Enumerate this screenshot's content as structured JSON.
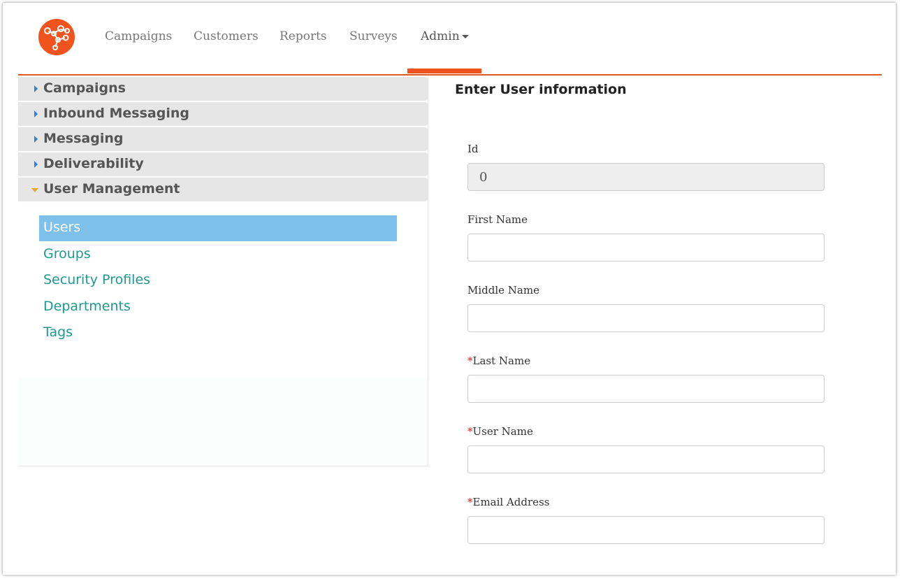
{
  "brand": {
    "logo_icon": "network-nodes-icon",
    "accent": "#f0531d"
  },
  "nav": {
    "items": [
      "Campaigns",
      "Customers",
      "Reports",
      "Surveys"
    ],
    "admin_label": "Admin"
  },
  "sidebar": {
    "sections": [
      {
        "label": "Campaigns",
        "expanded": false
      },
      {
        "label": "Inbound Messaging",
        "expanded": false
      },
      {
        "label": "Messaging",
        "expanded": false
      },
      {
        "label": "Deliverability",
        "expanded": false
      },
      {
        "label": "User Management",
        "expanded": true
      }
    ],
    "user_management_items": [
      "Users",
      "Groups",
      "Security Profiles",
      "Departments",
      "Tags"
    ],
    "selected_item": "Users"
  },
  "form": {
    "title": "Enter User information",
    "required_marker": "*",
    "fields": {
      "id": {
        "label": "Id",
        "value": "0"
      },
      "first_name": {
        "label": "First Name",
        "value": ""
      },
      "middle_name": {
        "label": "Middle Name",
        "value": ""
      },
      "last_name": {
        "label": "Last Name",
        "value": ""
      },
      "user_name": {
        "label": "User Name",
        "value": ""
      },
      "email": {
        "label": "Email Address",
        "value": ""
      }
    }
  }
}
